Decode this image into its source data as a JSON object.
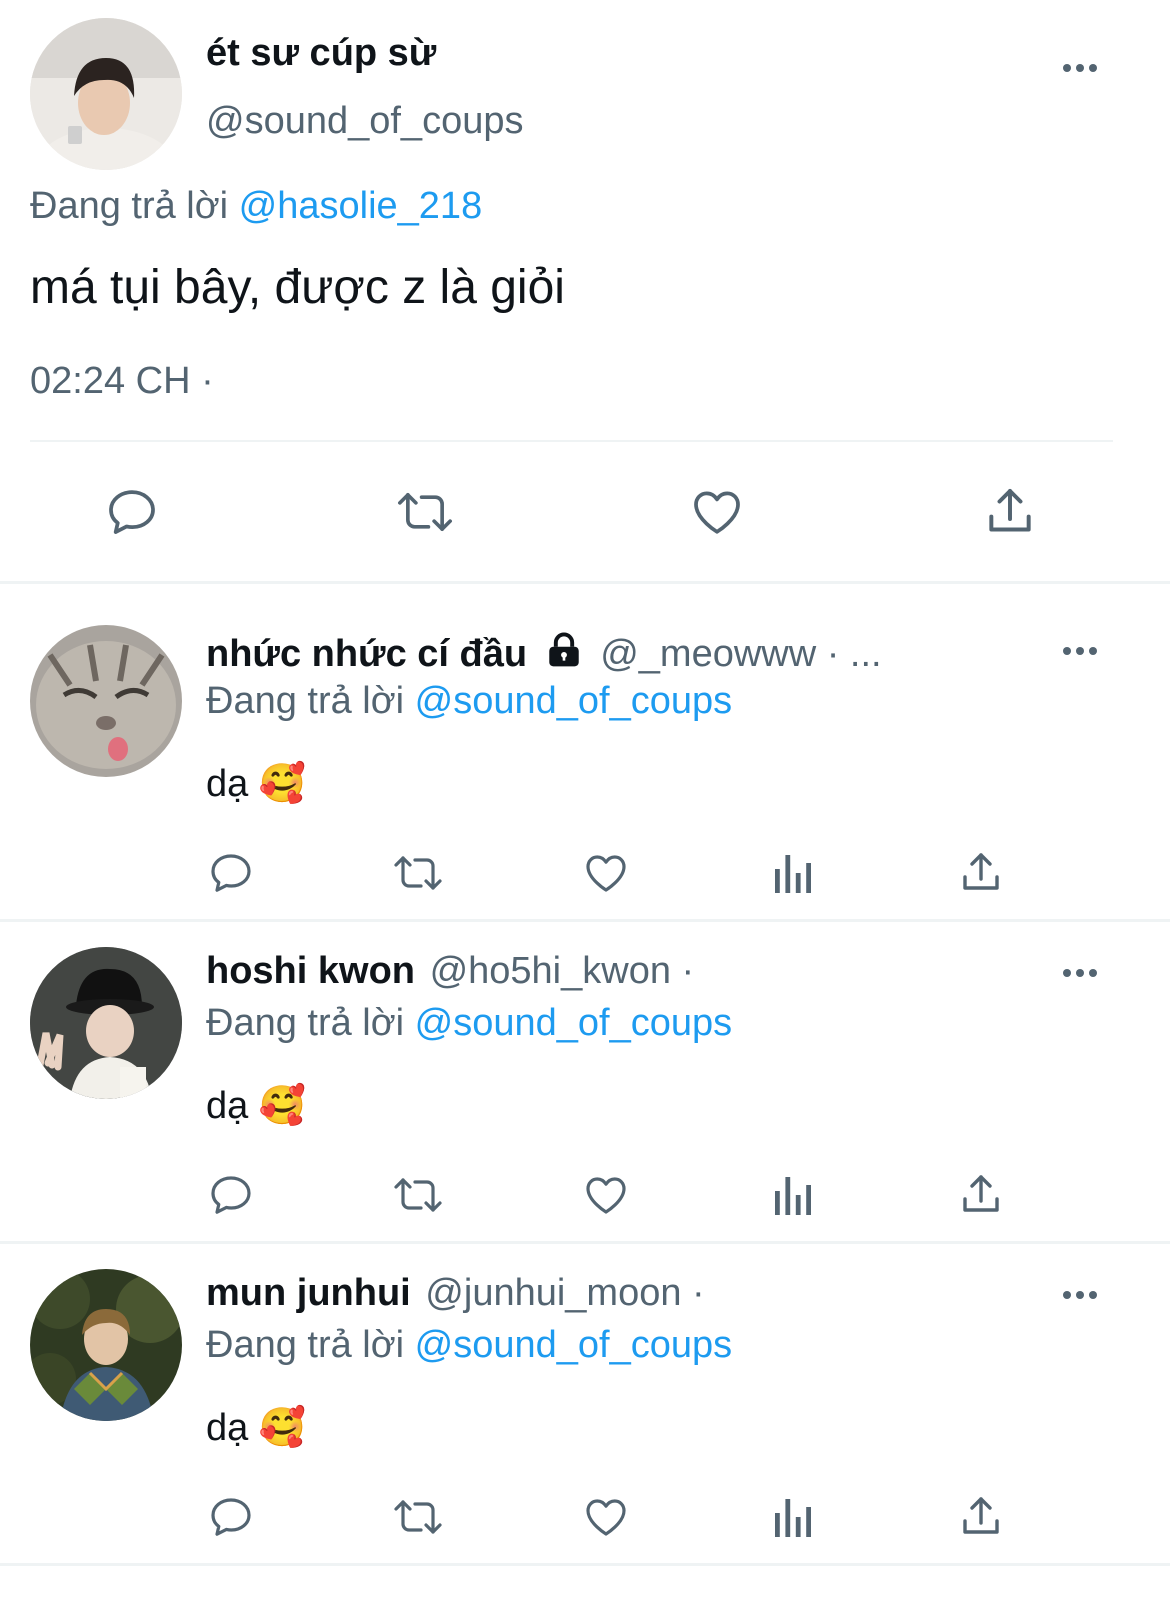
{
  "main_tweet": {
    "display_name": "ét sư cúp sừ",
    "handle": "@sound_of_coups",
    "replying_label": "Đang trả lời",
    "replying_to": "@hasolie_218",
    "text": "má tụi bây, được z là giỏi",
    "timestamp": "02:24 CH ·",
    "actions": [
      "reply-icon",
      "retweet-icon",
      "like-icon",
      "share-icon"
    ]
  },
  "replies": [
    {
      "display_name": "nhức nhức cí đầu",
      "lock": "lock-icon",
      "handle": "@_meowww · ...",
      "replying_label": "Đang trả lời",
      "replying_to": "@sound_of_coups",
      "text": "dạ 🥰"
    },
    {
      "display_name": "hoshi kwon",
      "handle": "@ho5hi_kwon ·",
      "replying_label": "Đang trả lời",
      "replying_to": "@sound_of_coups",
      "text": "dạ 🥰"
    },
    {
      "display_name": "mun junhui",
      "handle": "@junhui_moon ·",
      "replying_label": "Đang trả lời",
      "replying_to": "@sound_of_coups",
      "text": "dạ 🥰"
    }
  ],
  "colors": {
    "accent": "#1d9bf0",
    "muted": "#536471",
    "divider": "#eff3f4"
  }
}
